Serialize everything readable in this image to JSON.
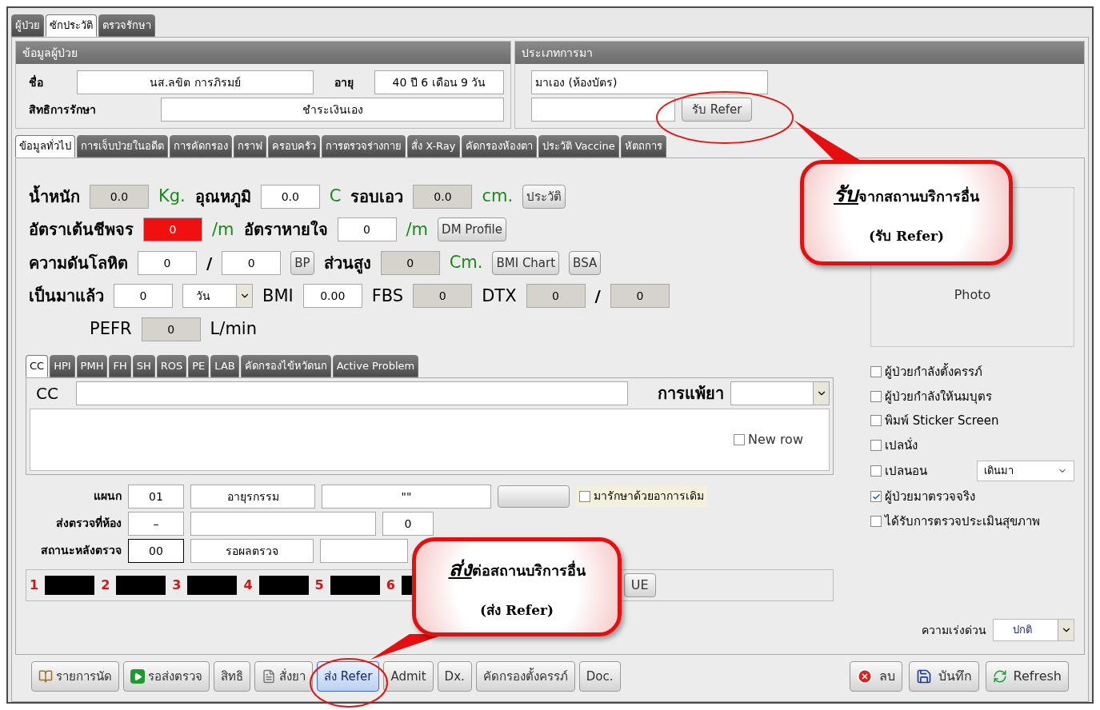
{
  "main_tabs": [
    {
      "label": "ผู้ป่วย",
      "selected": false
    },
    {
      "label": "ซักประวัติ",
      "selected": true
    },
    {
      "label": "ตรวจรักษา",
      "selected": false
    }
  ],
  "patient": {
    "title": "ข้อมูลผู้ป่วย",
    "name_label": "ชื่อ",
    "name": "นส.ลขิต การภิรมย์",
    "age_label": "อายุ",
    "age": "40 ปี 6 เดือน 9 วัน",
    "rights_label": "สิทธิการรักษา",
    "rights": "ชำระเงินเอง"
  },
  "visit_type": {
    "title": "ประเภทการมา",
    "value": "มาเอง (ห้องบัตร)",
    "button": "รับ Refer"
  },
  "sub_tabs": [
    {
      "label": "ข้อมูลทั่วไป",
      "selected": true
    },
    {
      "label": "การเจ็บป่วยในอดีต",
      "selected": false
    },
    {
      "label": "การคัดกรอง",
      "selected": false
    },
    {
      "label": "กราฟ",
      "selected": false
    },
    {
      "label": "ครอบครัว",
      "selected": false
    },
    {
      "label": "การตรวจร่างกาย",
      "selected": false
    },
    {
      "label": "สั่ง X-Ray",
      "selected": false
    },
    {
      "label": "คัดกรองห้องตา",
      "selected": false
    },
    {
      "label": "ประวัติ Vaccine",
      "selected": false
    },
    {
      "label": "หัตถการ",
      "selected": false
    }
  ],
  "vitals": [
    [
      {
        "kind": "label",
        "text": "น้ำหนัก"
      },
      {
        "kind": "field",
        "value": "0.0",
        "readonly": true,
        "alert": false
      },
      {
        "kind": "unit",
        "text": "Kg.",
        "color": "#1a8a1a"
      },
      {
        "kind": "label",
        "text": "อุณหภูมิ"
      },
      {
        "kind": "field",
        "value": "0.0",
        "readonly": false,
        "alert": false
      },
      {
        "kind": "unit",
        "text": "C",
        "color": "#1a8a1a"
      },
      {
        "kind": "label",
        "text": "รอบเอว"
      },
      {
        "kind": "field",
        "value": "0.0",
        "readonly": true,
        "alert": false
      },
      {
        "kind": "unit",
        "text": "cm.",
        "color": "#1a8a1a"
      },
      {
        "kind": "button",
        "text": "ประวัติ"
      }
    ],
    [
      {
        "kind": "label",
        "text": "อัตราเต้นชีพจร"
      },
      {
        "kind": "field",
        "value": "0",
        "readonly": false,
        "alert": true
      },
      {
        "kind": "unit",
        "text": "/m",
        "color": "#1a8a1a"
      },
      {
        "kind": "label",
        "text": "อัตราหายใจ"
      },
      {
        "kind": "field",
        "value": "0",
        "readonly": false,
        "alert": false
      },
      {
        "kind": "unit",
        "text": "/m",
        "color": "#1a8a1a"
      },
      {
        "kind": "button",
        "text": "DM Profile"
      }
    ],
    [
      {
        "kind": "label",
        "text": "ความดันโลหิต"
      },
      {
        "kind": "field",
        "value": "0",
        "readonly": false,
        "alert": false
      },
      {
        "kind": "sep",
        "text": "/"
      },
      {
        "kind": "field",
        "value": "0",
        "readonly": false,
        "alert": false
      },
      {
        "kind": "button",
        "text": "BP"
      },
      {
        "kind": "label",
        "text": "ส่วนสูง"
      },
      {
        "kind": "field",
        "value": "0",
        "readonly": true,
        "alert": false
      },
      {
        "kind": "unit",
        "text": "Cm.",
        "color": "#1a8a1a"
      },
      {
        "kind": "button",
        "text": "BMI Chart"
      },
      {
        "kind": "button",
        "text": "BSA"
      }
    ],
    [
      {
        "kind": "label",
        "text": "เป็นมาแล้ว"
      },
      {
        "kind": "field",
        "value": "0",
        "readonly": false,
        "alert": false
      },
      {
        "kind": "select",
        "value": "วัน"
      },
      {
        "kind": "code",
        "text": "BMI"
      },
      {
        "kind": "field",
        "value": "0.00",
        "readonly": false,
        "alert": false
      },
      {
        "kind": "code",
        "text": "FBS"
      },
      {
        "kind": "field",
        "value": "0",
        "readonly": true,
        "alert": false
      },
      {
        "kind": "code",
        "text": "DTX"
      },
      {
        "kind": "field",
        "value": "0",
        "readonly": true,
        "alert": false
      },
      {
        "kind": "sep",
        "text": "/"
      },
      {
        "kind": "field",
        "value": "0",
        "readonly": true,
        "alert": false
      }
    ],
    [
      {
        "kind": "code",
        "text": "PEFR"
      },
      {
        "kind": "field",
        "value": "0",
        "readonly": true,
        "alert": false
      },
      {
        "kind": "unit",
        "text": "L/min",
        "color": "#000000"
      }
    ]
  ],
  "history_tabs": [
    {
      "label": "CC",
      "selected": true
    },
    {
      "label": "HPI",
      "selected": false
    },
    {
      "label": "PMH",
      "selected": false
    },
    {
      "label": "FH",
      "selected": false
    },
    {
      "label": "SH",
      "selected": false
    },
    {
      "label": "ROS",
      "selected": false
    },
    {
      "label": "PE",
      "selected": false
    },
    {
      "label": "LAB",
      "selected": false
    },
    {
      "label": "คัดกรองไข้หวัดนก",
      "selected": false
    },
    {
      "label": "Active Problem",
      "selected": false
    }
  ],
  "cc": {
    "label": "CC",
    "allergy_label": "การแพ้ยา",
    "new_row": {
      "label": "New row",
      "checked": false
    }
  },
  "dept_rows": [
    {
      "label": "แผนก",
      "fields": [
        {
          "value": "01",
          "focused": false
        },
        {
          "value": "อายุรกรรม",
          "focused": false
        },
        {
          "value": "\"\"",
          "focused": false
        }
      ]
    },
    {
      "label": "ส่งตรวจที่ห้อง",
      "fields": [
        {
          "value": "–",
          "focused": false
        },
        {
          "focused": false
        },
        {
          "value": "0",
          "focused": false
        }
      ]
    },
    {
      "label": "สถานะหลังตรวจ",
      "fields": [
        {
          "value": "00",
          "focused": true
        },
        {
          "value": "รอผลตรวจ",
          "focused": false
        },
        {
          "focused": false
        }
      ]
    }
  ],
  "revisit": {
    "label": "มารักษาด้วยอาการเดิม",
    "checked": false
  },
  "slots": [
    "1",
    "2",
    "3",
    "4",
    "5",
    "6"
  ],
  "extra_button": "UE",
  "photo": {
    "label": "Photo"
  },
  "options": [
    {
      "label": "ผู้ป่วยกำลังตั้งครรภ์",
      "checked": false
    },
    {
      "label": "ผู้ป่วยกำลังให้นมบุตร",
      "checked": false
    },
    {
      "label": "พิมพ์ Sticker Screen",
      "checked": false
    },
    {
      "label": "เปลนั่ง",
      "checked": false
    },
    {
      "label": "เปลนอน",
      "checked": false
    },
    {
      "label": "ผู้ป่วยมาตรวจจริง",
      "checked": true
    },
    {
      "label": "ได้รับการตรวจประเมินสุขภาพ",
      "checked": false
    }
  ],
  "transport": "เดินมา",
  "urgency": {
    "label": "ความเร่งด่วน",
    "value": "ปกติ"
  },
  "footer_buttons": [
    {
      "label": "รายการนัด",
      "highlighted": false
    },
    {
      "label": "รอส่งตรวจ",
      "highlighted": false
    },
    {
      "label": "สิทธิ",
      "highlighted": false
    },
    {
      "label": "สั่งยา",
      "highlighted": false
    },
    {
      "label": "ส่ง Refer",
      "highlighted": true
    },
    {
      "label": "Admit",
      "highlighted": false
    },
    {
      "label": "Dx.",
      "highlighted": false
    },
    {
      "label": "คัดกรองตั้งครรภ์",
      "highlighted": false
    },
    {
      "label": "Doc.",
      "highlighted": false
    }
  ],
  "footer_actions": [
    {
      "label": "ลบ"
    },
    {
      "label": "บันทึก"
    },
    {
      "label": "Refresh"
    }
  ],
  "callouts": [
    {
      "emphasis": "รับ",
      "text": "จากสถานบริการอื่น",
      "sub": "(รับ Refer)"
    },
    {
      "emphasis": "ส่ง",
      "text": "ต่อสถานบริการอื่น",
      "sub": "(ส่ง Refer)"
    }
  ]
}
